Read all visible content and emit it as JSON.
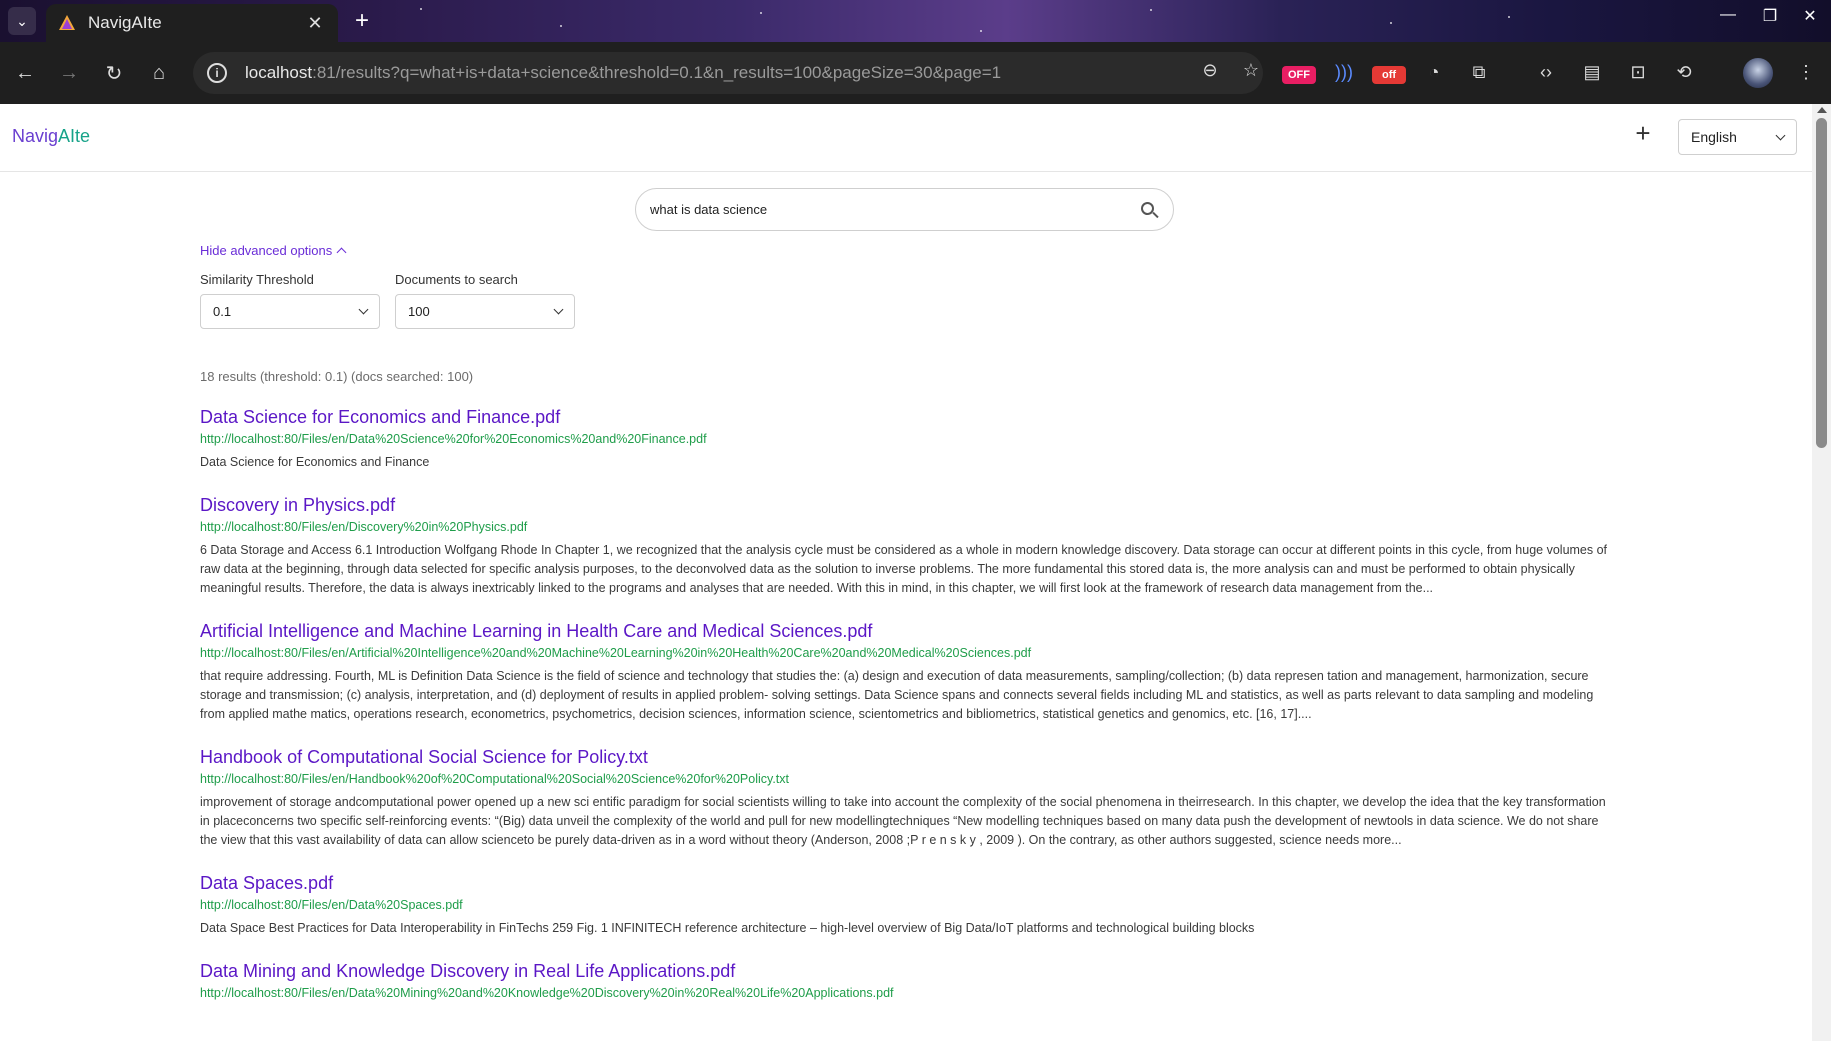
{
  "browser": {
    "tab_title": "NavigAIte",
    "url_host": "localhost",
    "url_rest": ":81/results?q=what+is+data+science&threshold=0.1&n_results=100&pageSize=30&page=1",
    "off_badge_1": "OFF",
    "off_badge_2": "off"
  },
  "app": {
    "logo_part1": "Navig",
    "logo_part2": "AIte",
    "language": "English"
  },
  "search": {
    "query": "what is data science"
  },
  "advanced": {
    "toggle_label": "Hide advanced options",
    "threshold_label": "Similarity Threshold",
    "threshold_value": "0.1",
    "docs_label": "Documents to search",
    "docs_value": "100"
  },
  "summary": "18 results (threshold: 0.1) (docs searched: 100)",
  "results": [
    {
      "title": "Data Science for Economics and Finance.pdf",
      "url": "http://localhost:80/Files/en/Data%20Science%20for%20Economics%20and%20Finance.pdf",
      "snippet": "Data Science for Economics and Finance"
    },
    {
      "title": "Discovery in Physics.pdf",
      "url": "http://localhost:80/Files/en/Discovery%20in%20Physics.pdf",
      "snippet": "6 Data Storage and Access 6.1 Introduction Wolfgang Rhode In Chapter 1, we recognized that the analysis cycle must be considered as a whole in modern knowledge discovery. Data storage can occur at different points in this cycle, from huge volumes of raw data at the beginning, through data selected for specific analysis purposes, to the deconvolved data as the solution to inverse problems. The more fundamental this stored data is, the more analysis can and must be performed to obtain physically meaningful results. Therefore, the data is always inextricably linked to the programs and analyses that are needed. With this in mind, in this chapter, we will first look at the framework of research data management from the..."
    },
    {
      "title": "Artificial Intelligence and Machine Learning in Health Care and Medical Sciences.pdf",
      "url": "http://localhost:80/Files/en/Artificial%20Intelligence%20and%20Machine%20Learning%20in%20Health%20Care%20and%20Medical%20Sciences.pdf",
      "snippet": "that require addressing. Fourth, ML is Definition Data Science is the field of science and technology that studies the: (a) design and execution of data measurements, sampling/collection; (b) data represen tation and management, harmonization, secure storage and transmission; (c) analysis, interpretation, and (d) deployment of results in applied problem- solving settings. Data Science spans and connects several fields including ML and statistics, as well as parts relevant to data sampling and modeling from applied mathe matics, operations research, econometrics, psychometrics, decision sciences, information science, scientometrics and bibliometrics, statistical genetics and genomics, etc. [16, 17]...."
    },
    {
      "title": "Handbook of Computational Social Science for Policy.txt",
      "url": "http://localhost:80/Files/en/Handbook%20of%20Computational%20Social%20Science%20for%20Policy.txt",
      "snippet": "improvement of storage andcomputational power opened up a new sci entific paradigm for social scientists willing to take into account the complexity of the social phenomena in theirresearch. In this chapter, we develop the idea that the key transformation in placeconcerns two specific self-reinforcing events: “(Big) data unveil the complexity of the world and pull for new modellingtechniques “New modelling techniques based on many data push the development of newtools in data science. We do not share the view that this vast availability of data can allow scienceto be purely data-driven as in a word without theory (Anderson, 2008 ;P r e n s k y , 2009 ). On the contrary, as other authors suggested, science needs more..."
    },
    {
      "title": "Data Spaces.pdf",
      "url": "http://localhost:80/Files/en/Data%20Spaces.pdf",
      "snippet": "Data Space Best Practices for Data Interoperability in FinTechs 259 Fig. 1 INFINITECH reference architecture – high-level overview of Big Data/IoT platforms and technological building blocks"
    },
    {
      "title": "Data Mining and Knowledge Discovery in Real Life Applications.pdf",
      "url": "http://localhost:80/Files/en/Data%20Mining%20and%20Knowledge%20Discovery%20in%20Real%20Life%20Applications.pdf",
      "snippet": ""
    }
  ]
}
